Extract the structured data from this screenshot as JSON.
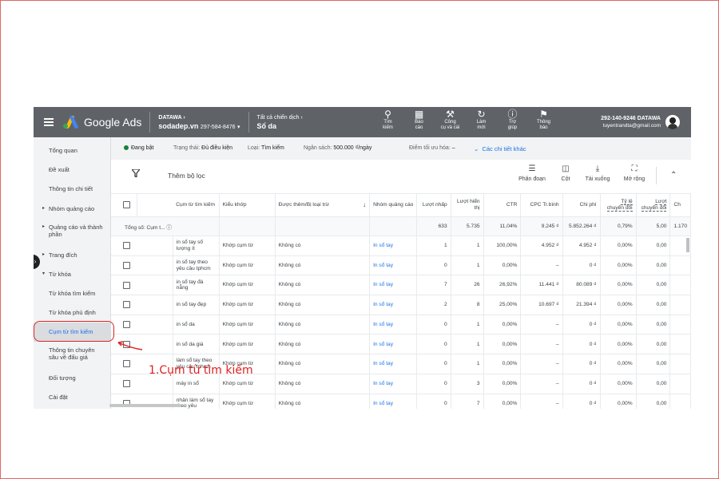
{
  "topbar": {
    "brand": "Google Ads",
    "account_label": "DATAWA",
    "account_name": "sodadep.vn",
    "account_id": "297-584-8476",
    "campaign_label": "Tất cả chiến dịch",
    "campaign_name": "Sổ da",
    "tools": [
      {
        "icon": "search-icon",
        "label1": "Tìm",
        "label2": "kiếm"
      },
      {
        "icon": "reports-icon",
        "label1": "Báo",
        "label2": "cáo"
      },
      {
        "icon": "tools-icon",
        "label1": "Công",
        "label2": "cụ và cài"
      },
      {
        "icon": "refresh-icon",
        "label1": "Làm",
        "label2": "mới"
      },
      {
        "icon": "help-icon",
        "label1": "Trợ",
        "label2": "giúp"
      },
      {
        "icon": "notifications-icon",
        "label1": "Thông",
        "label2": "báo"
      }
    ],
    "user_account": "292-140-9246 DATAWA",
    "user_email": "tuyentrandta@gmail.com"
  },
  "sidebar": {
    "items": [
      {
        "label": "Tổng quan"
      },
      {
        "label": "Đề xuất"
      },
      {
        "label": "Thông tin chi tiết"
      },
      {
        "label": "Nhóm quảng cáo"
      },
      {
        "label": "Quảng cáo và thành phần"
      },
      {
        "label": "Trang đích"
      },
      {
        "label": "Từ khóa"
      },
      {
        "label": "Từ khóa tìm kiếm"
      },
      {
        "label": "Từ khóa phủ định"
      },
      {
        "label": "Cụm từ tìm kiếm"
      },
      {
        "label": "Thông tin chuyên sâu về đấu giá"
      },
      {
        "label": "Đối tượng"
      },
      {
        "label": "Cài đặt"
      }
    ]
  },
  "summary": {
    "status": "Đang bật",
    "status_type_label": "Trạng thái:",
    "status_type_value": "Đủ điều kiện",
    "type_label": "Loại:",
    "type_value": "Tìm kiếm",
    "budget_label": "Ngân sách:",
    "budget_value": "500.000 ₫/ngày",
    "optimization_label": "Điểm tối ưu hóa:",
    "optimization_value": "–",
    "details_link": "Các chi tiết khác"
  },
  "filterbar": {
    "add_filter": "Thêm bộ lọc",
    "segment": "Phân đoạn",
    "columns": "Cột",
    "download": "Tải xuống",
    "expand": "Mở rộng"
  },
  "table": {
    "headers": {
      "term": "Cụm từ tìm kiếm",
      "match": "Kiểu khớp",
      "added": "Được thêm/Bị loại trừ",
      "adgroup": "Nhóm quảng cáo",
      "clicks": "Lượt nhấp",
      "impr": "Lượt hiển thị",
      "ctr": "CTR",
      "cpc": "CPC Tr.bình",
      "cost": "Chi phí",
      "conv_rate": "Tỷ lệ chuyển đổi",
      "conv": "Lượt chuyển đổi",
      "more": "Ch"
    },
    "total": {
      "label": "Tổng số: Cụm t...",
      "clicks": "633",
      "impr": "5.735",
      "ctr": "11,04%",
      "cpc": "9.245 ₫",
      "cost": "5.852.264 ₫",
      "conv_rate": "0,79%",
      "conv": "5,00",
      "more": "1.170"
    },
    "rows": [
      {
        "term": "in sổ tay số lượng ít",
        "match": "Khớp cụm từ",
        "added": "Không có",
        "adgroup": "In sổ tay",
        "clicks": "1",
        "impr": "1",
        "ctr": "100,00%",
        "cpc": "4.952 ₫",
        "cost": "4.952 ₫",
        "conv_rate": "0,00%",
        "conv": "0,00"
      },
      {
        "term": "in sổ tay theo yêu cầu tphcm",
        "match": "Khớp cụm từ",
        "added": "Không có",
        "adgroup": "In sổ tay",
        "clicks": "0",
        "impr": "1",
        "ctr": "0,00%",
        "cpc": "–",
        "cost": "0 ₫",
        "conv_rate": "0,00%",
        "conv": "0,00"
      },
      {
        "term": "in sổ tay đà nẵng",
        "match": "Khớp cụm từ",
        "added": "Không có",
        "adgroup": "In sổ tay",
        "clicks": "7",
        "impr": "26",
        "ctr": "26,92%",
        "cpc": "11.441 ₫",
        "cost": "80.089 ₫",
        "conv_rate": "0,00%",
        "conv": "0,00"
      },
      {
        "term": "in sổ tay đẹp",
        "match": "Khớp cụm từ",
        "added": "Không có",
        "adgroup": "In sổ tay",
        "clicks": "2",
        "impr": "8",
        "ctr": "25,00%",
        "cpc": "10.697 ₫",
        "cost": "21.394 ₫",
        "conv_rate": "0,00%",
        "conv": "0,00"
      },
      {
        "term": "in sổ da",
        "match": "Khớp cụm từ",
        "added": "Không có",
        "adgroup": "In sổ tay",
        "clicks": "0",
        "impr": "1",
        "ctr": "0,00%",
        "cpc": "–",
        "cost": "0 ₫",
        "conv_rate": "0,00%",
        "conv": "0,00"
      },
      {
        "term": "in sổ da giá",
        "match": "Khớp cụm từ",
        "added": "Không có",
        "adgroup": "In sổ tay",
        "clicks": "0",
        "impr": "1",
        "ctr": "0,00%",
        "cpc": "–",
        "cost": "0 ₫",
        "conv_rate": "0,00%",
        "conv": "0,00"
      },
      {
        "term": "làm sổ tay theo yêu cầu tphcm",
        "match": "Khớp cụm từ",
        "added": "Không có",
        "adgroup": "In sổ tay",
        "clicks": "0",
        "impr": "1",
        "ctr": "0,00%",
        "cpc": "–",
        "cost": "0 ₫",
        "conv_rate": "0,00%",
        "conv": "0,00"
      },
      {
        "term": "máy in sổ",
        "match": "Khớp cụm từ",
        "added": "Không có",
        "adgroup": "In sổ tay",
        "clicks": "0",
        "impr": "3",
        "ctr": "0,00%",
        "cpc": "–",
        "cost": "0 ₫",
        "conv_rate": "0,00%",
        "conv": "0,00"
      },
      {
        "term": "nhận làm sổ tay theo yêu",
        "match": "Khớp cụm từ",
        "added": "Không có",
        "adgroup": "In sổ tay",
        "clicks": "0",
        "impr": "7",
        "ctr": "0,00%",
        "cpc": "–",
        "cost": "0 ₫",
        "conv_rate": "0,00%",
        "conv": "0,00"
      }
    ]
  },
  "annotation": {
    "text": "1.Cụm từ tìm kiếm",
    "color": "#e02020"
  },
  "colors": {
    "topbar": "#5f6368",
    "link": "#1a73e8",
    "status_green": "#188038"
  }
}
